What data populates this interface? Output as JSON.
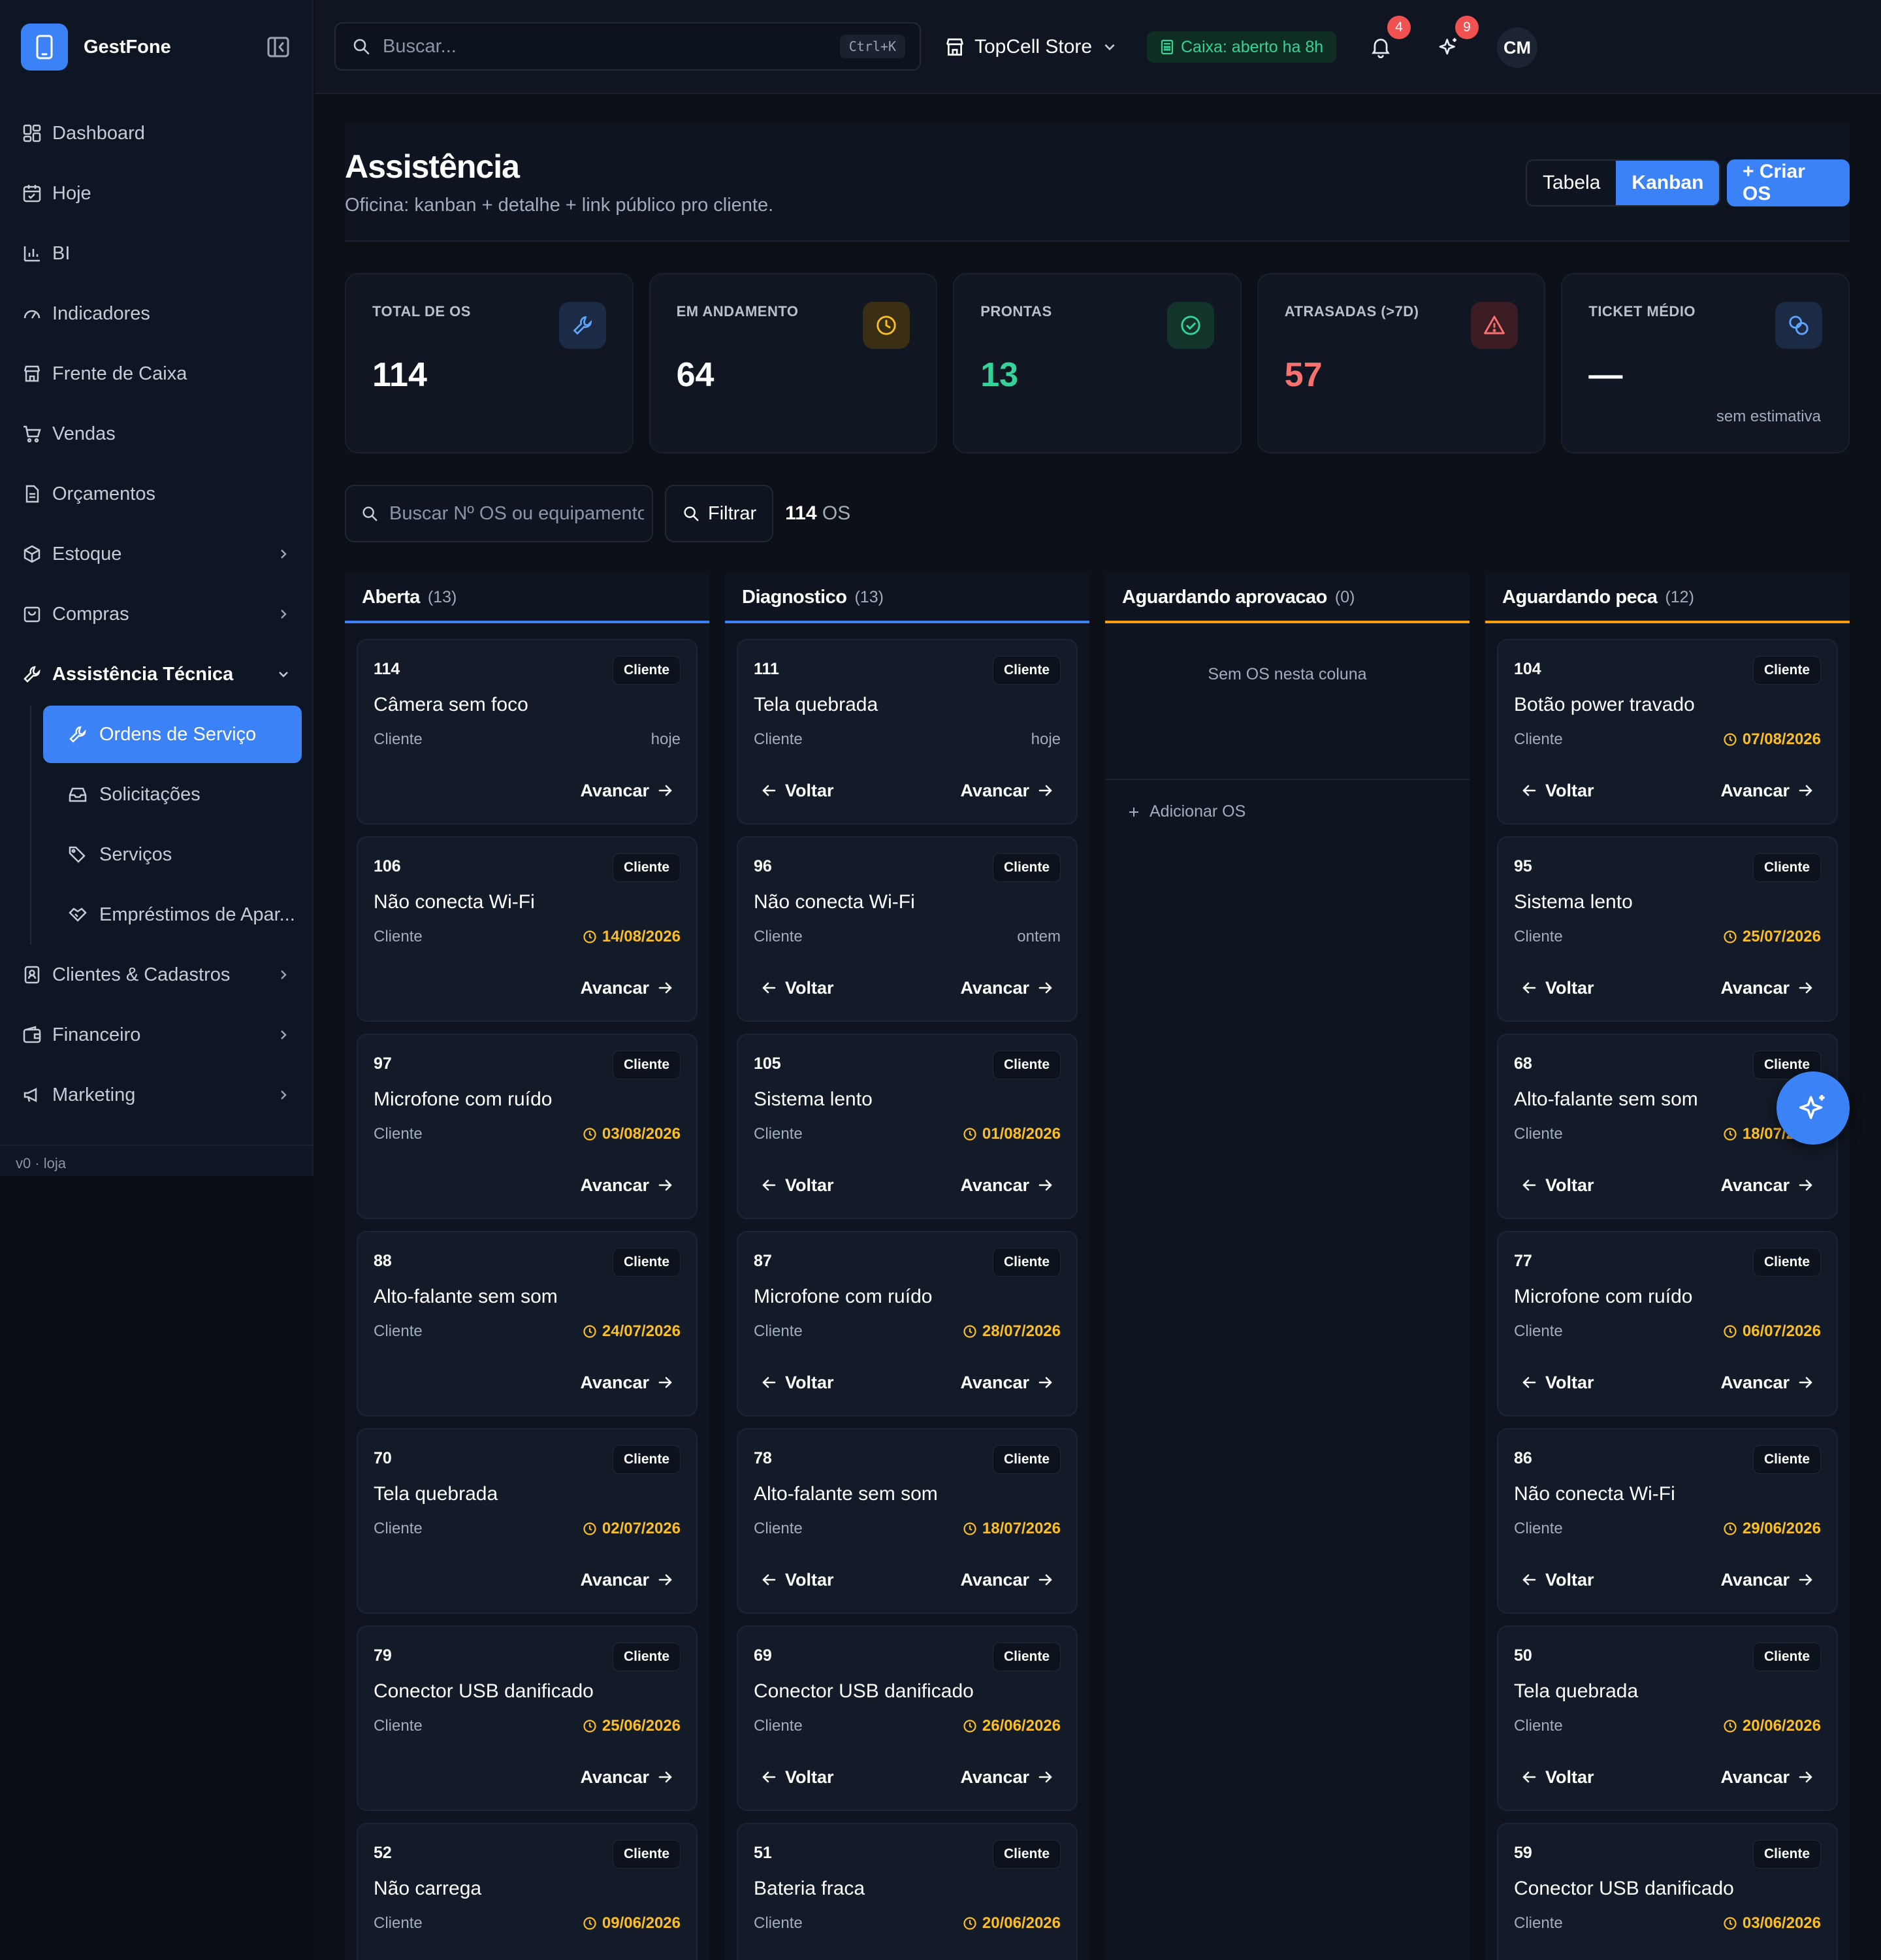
{
  "brand": {
    "name": "GestFone"
  },
  "nav": {
    "dashboard": "Dashboard",
    "hoje": "Hoje",
    "bi": "BI",
    "indicadores": "Indicadores",
    "frente": "Frente de Caixa",
    "vendas": "Vendas",
    "orcamentos": "Orçamentos",
    "estoque": "Estoque",
    "compras": "Compras",
    "assistencia": "Assistência Técnica",
    "sub": {
      "ordens": "Ordens de Serviço",
      "solicitacoes": "Solicitações",
      "servicos": "Serviços",
      "emprestimos": "Empréstimos de Apar..."
    },
    "clientes": "Clientes & Cadastros",
    "financeiro": "Financeiro",
    "marketing": "Marketing"
  },
  "version": "v0 · loja",
  "topbar": {
    "search_placeholder": "Buscar...",
    "shortcut": "Ctrl+K",
    "store": "TopCell Store",
    "caixa": "Caixa: aberto ha 8h",
    "notifications_count": "4",
    "ai_count": "9",
    "avatar": "CM"
  },
  "header": {
    "title": "Assistência",
    "subtitle": "Oficina: kanban + detalhe + link público pro cliente.",
    "view_table": "Tabela",
    "view_kanban": "Kanban",
    "create": "+ Criar OS"
  },
  "stats": [
    {
      "label": "TOTAL DE OS",
      "value": "114",
      "color": "#ffffff",
      "icon": "wrench-icon"
    },
    {
      "label": "EM ANDAMENTO",
      "value": "64",
      "color": "#ffffff",
      "icon": "clock-icon"
    },
    {
      "label": "PRONTAS",
      "value": "13",
      "color": "#34d399",
      "icon": "check-circle-icon"
    },
    {
      "label": "ATRASADAS (>7D)",
      "value": "57",
      "color": "#f87171",
      "icon": "alert-triangle-icon"
    },
    {
      "label": "TICKET MÉDIO",
      "value": "—",
      "color": "#ffffff",
      "icon": "coins-icon",
      "note": "sem estimativa"
    }
  ],
  "filter": {
    "placeholder": "Buscar Nº OS ou equipamento",
    "button": "Filtrar",
    "count": "114",
    "count_unit": "OS"
  },
  "labels": {
    "client_tag": "Cliente",
    "client": "Cliente",
    "back": "Voltar",
    "next": "Avancar",
    "empty": "Sem OS nesta coluna",
    "add": "Adicionar OS"
  },
  "columns": [
    {
      "title": "Aberta",
      "count": "(13)",
      "accent": "#3b82f6",
      "cards": [
        {
          "num": "114",
          "title": "Câmera sem foco",
          "when": "hoje",
          "due": false
        },
        {
          "num": "106",
          "title": "Não conecta Wi-Fi",
          "when": "14/08/2026",
          "due": true
        },
        {
          "num": "97",
          "title": "Microfone com ruído",
          "when": "03/08/2026",
          "due": true
        },
        {
          "num": "88",
          "title": "Alto-falante sem som",
          "when": "24/07/2026",
          "due": true
        },
        {
          "num": "70",
          "title": "Tela quebrada",
          "when": "02/07/2026",
          "due": true
        },
        {
          "num": "79",
          "title": "Conector USB danificado",
          "when": "25/06/2026",
          "due": true
        },
        {
          "num": "52",
          "title": "Não carrega",
          "when": "09/06/2026",
          "due": true
        }
      ]
    },
    {
      "title": "Diagnostico",
      "count": "(13)",
      "accent": "#3b82f6",
      "cards": [
        {
          "num": "111",
          "title": "Tela quebrada",
          "when": "hoje",
          "due": false
        },
        {
          "num": "96",
          "title": "Não conecta Wi-Fi",
          "when": "ontem",
          "due": false
        },
        {
          "num": "105",
          "title": "Sistema lento",
          "when": "01/08/2026",
          "due": true
        },
        {
          "num": "87",
          "title": "Microfone com ruído",
          "when": "28/07/2026",
          "due": true
        },
        {
          "num": "78",
          "title": "Alto-falante sem som",
          "when": "18/07/2026",
          "due": true
        },
        {
          "num": "69",
          "title": "Conector USB danificado",
          "when": "26/06/2026",
          "due": true
        },
        {
          "num": "51",
          "title": "Bateria fraca",
          "when": "20/06/2026",
          "due": true
        }
      ]
    },
    {
      "title": "Aguardando aprovacao",
      "count": "(0)",
      "accent": "#f59e0b",
      "cards": []
    },
    {
      "title": "Aguardando peca",
      "count": "(12)",
      "accent": "#f59e0b",
      "cards": [
        {
          "num": "104",
          "title": "Botão power travado",
          "when": "07/08/2026",
          "due": true
        },
        {
          "num": "95",
          "title": "Sistema lento",
          "when": "25/07/2026",
          "due": true
        },
        {
          "num": "68",
          "title": "Alto-falante sem som",
          "when": "18/07/2026",
          "due": true
        },
        {
          "num": "77",
          "title": "Microfone com ruído",
          "when": "06/07/2026",
          "due": true
        },
        {
          "num": "86",
          "title": "Não conecta Wi-Fi",
          "when": "29/06/2026",
          "due": true
        },
        {
          "num": "50",
          "title": "Tela quebrada",
          "when": "20/06/2026",
          "due": true
        },
        {
          "num": "59",
          "title": "Conector USB danificado",
          "when": "03/06/2026",
          "due": true
        }
      ]
    }
  ]
}
